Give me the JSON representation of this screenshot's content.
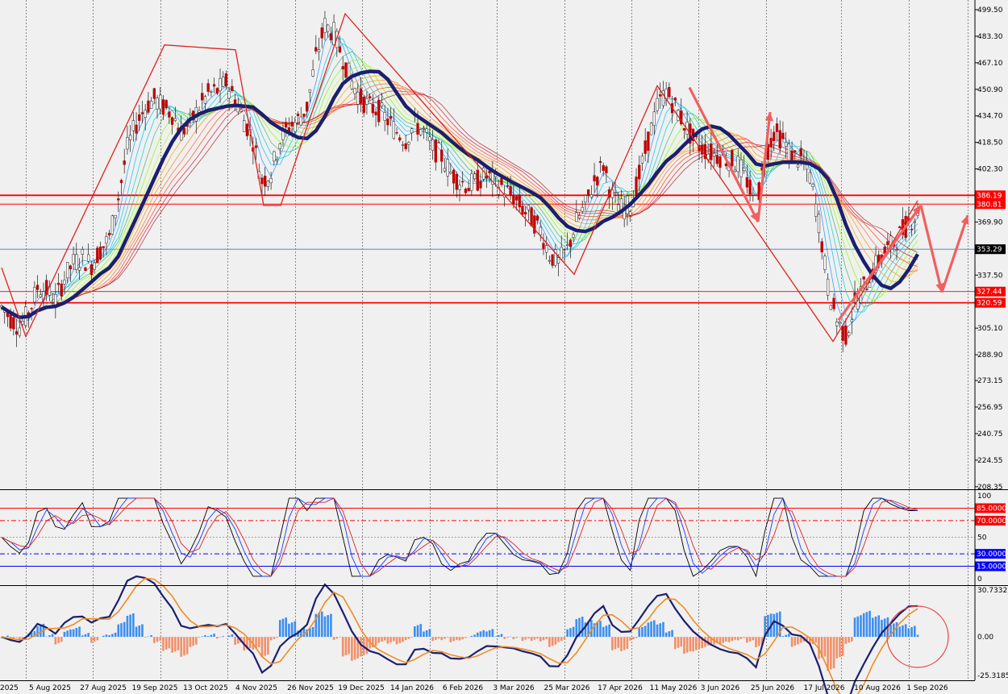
{
  "chart_data": {
    "type": "candlestick",
    "title": "",
    "xlabel": "",
    "ylabel": "",
    "ylim": [
      208.25,
      499.5
    ],
    "price_ticks": [
      "499.50",
      "483.30",
      "467.10",
      "450.90",
      "434.70",
      "418.50",
      "402.30",
      "385.90",
      "369.90",
      "353.70",
      "337.50",
      "321.30",
      "305.10",
      "288.90",
      "273.15",
      "256.95",
      "240.75",
      "224.55",
      "208.35"
    ],
    "date_labels": [
      "2025",
      "5 Aug 2025",
      "27 Aug 2025",
      "19 Sep 2025",
      "13 Oct 2025",
      "4 Nov 2025",
      "26 Nov 2025",
      "19 Dec 2025",
      "14 Jan 2026",
      "6 Feb 2026",
      "3 Mar 2026",
      "25 Mar 2026",
      "17 Apr 2026",
      "11 May 2026",
      "3 Jun 2026",
      "25 Jun 2026",
      "17 Jul 2026",
      "10 Aug 2026",
      "1 Sep 2026"
    ],
    "price_levels": [
      {
        "label": "386.19",
        "value": 386.19,
        "color": "#ff0000"
      },
      {
        "label": "380.81",
        "value": 380.81,
        "color": "#ff0000"
      },
      {
        "label": "327.44",
        "value": 327.44,
        "color": "#ff0000"
      },
      {
        "label": "320.59",
        "value": 320.59,
        "color": "#ff0000"
      }
    ],
    "current_price": {
      "label": "353.29",
      "value": 353.29
    },
    "close_series": [
      318,
      311,
      306,
      314,
      330,
      328,
      322,
      336,
      345,
      348,
      344,
      353,
      360,
      385,
      415,
      430,
      440,
      445,
      440,
      436,
      425,
      430,
      440,
      448,
      450,
      455,
      445,
      432,
      420,
      395,
      400,
      420,
      428,
      432,
      440,
      470,
      490,
      485,
      470,
      455,
      445,
      440,
      438,
      432,
      425,
      420,
      430,
      425,
      415,
      410,
      400,
      395,
      392,
      395,
      398,
      395,
      390,
      385,
      378,
      372,
      365,
      350,
      345,
      353,
      370,
      380,
      395,
      405,
      385,
      378,
      380,
      398,
      420,
      440,
      450,
      440,
      430,
      420,
      415,
      412,
      410,
      408,
      405,
      395,
      378,
      410,
      425,
      420,
      410,
      408,
      398,
      370,
      330,
      310,
      300,
      320,
      330,
      340,
      350,
      355,
      362,
      370,
      375
    ],
    "indicator1": {
      "levels": [
        {
          "label": "85.0000",
          "value": 85,
          "color": "#ff0000"
        },
        {
          "label": "70.0000",
          "value": 70,
          "color": "#ff0000"
        },
        {
          "label": "30.0000",
          "value": 30,
          "color": "#0000ff"
        },
        {
          "label": "15.0000",
          "value": 15,
          "color": "#0000ff"
        }
      ],
      "scale_labels": [
        "100",
        "50",
        "0"
      ]
    },
    "indicator2": {
      "scale_labels": [
        "30.7332",
        "0.00",
        "-25.3185"
      ],
      "ylim": [
        -25.3185,
        30.7332
      ]
    }
  }
}
